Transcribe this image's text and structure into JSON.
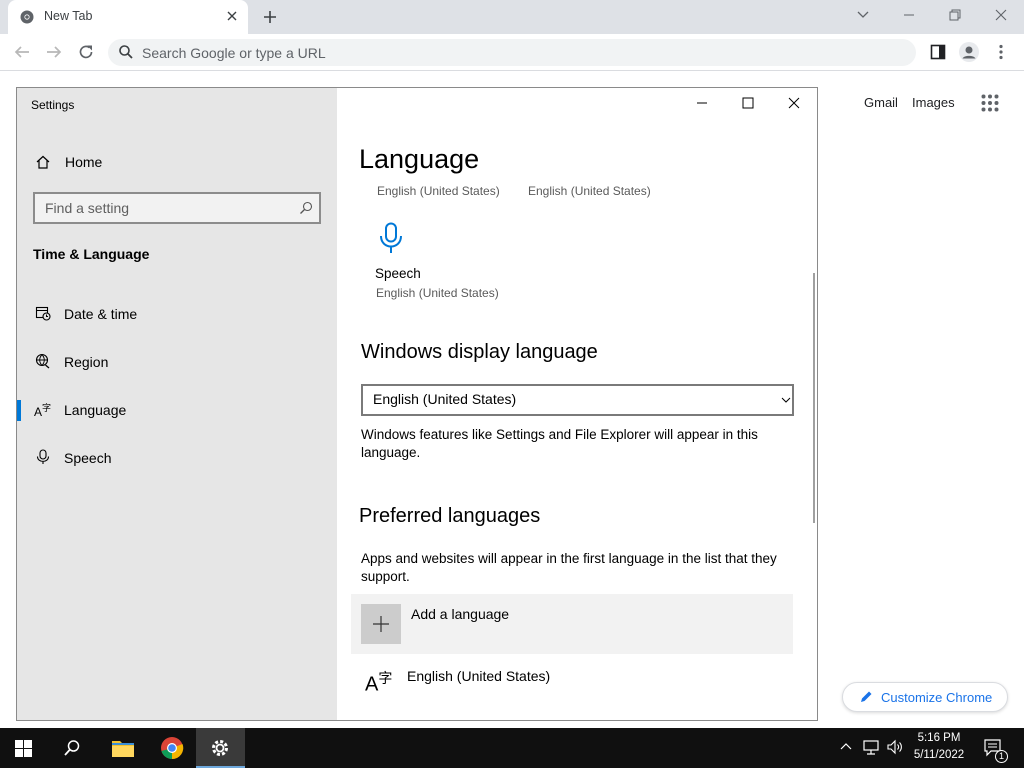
{
  "browser": {
    "tab_title": "New Tab",
    "omnibox_placeholder": "Search Google or type a URL",
    "links": {
      "gmail": "Gmail",
      "images": "Images"
    },
    "customize_label": "Customize Chrome"
  },
  "settings": {
    "window_title": "Settings",
    "nav": {
      "home": "Home",
      "search_placeholder": "Find a setting",
      "section": "Time & Language",
      "items": [
        {
          "label": "Date & time",
          "icon": "calendar-clock-icon"
        },
        {
          "label": "Region",
          "icon": "globe-icon"
        },
        {
          "label": "Language",
          "icon": "language-icon",
          "active": true
        },
        {
          "label": "Speech",
          "icon": "microphone-icon"
        }
      ]
    },
    "content": {
      "title": "Language",
      "top_labels": [
        "English (United States)",
        "English (United States)"
      ],
      "speech_tile": {
        "label": "Speech",
        "sub": "English (United States)"
      },
      "display_language": {
        "heading": "Windows display language",
        "selected": "English (United States)",
        "description": "Windows features like Settings and File Explorer will appear in this language."
      },
      "preferred": {
        "heading": "Preferred languages",
        "description": "Apps and websites will appear in the first language in the list that they support.",
        "add_label": "Add a language",
        "languages": [
          "English (United States)"
        ]
      }
    }
  },
  "taskbar": {
    "time": "5:16 PM",
    "date": "5/11/2022",
    "notification_count": "1"
  },
  "colors": {
    "accent": "#0078d7",
    "chrome_link": "#1a73e8",
    "taskbar": "#101010"
  }
}
